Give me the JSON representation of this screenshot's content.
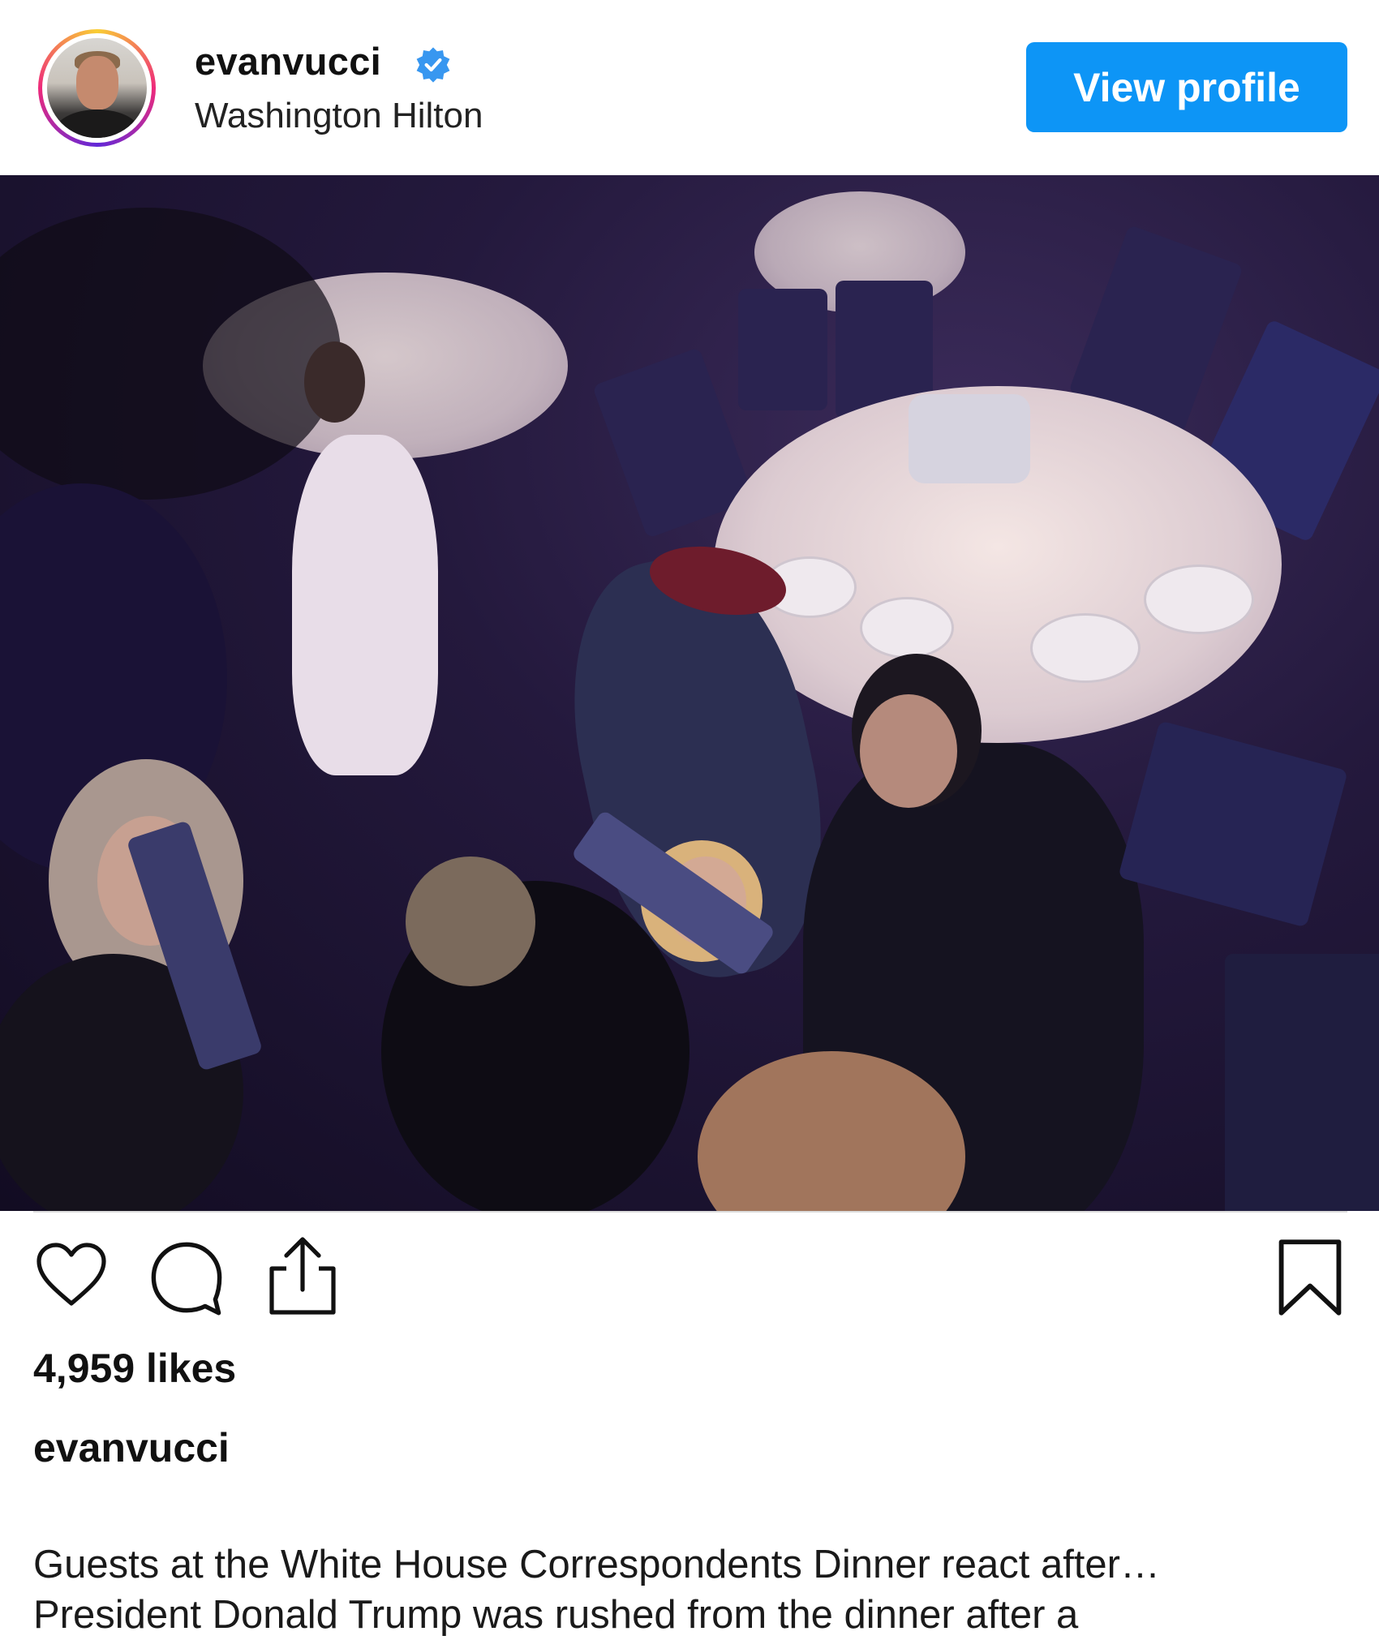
{
  "post": {
    "username": "evanvucci",
    "verified": true,
    "location": "Washington Hilton",
    "view_profile_label": "View profile",
    "photo_alt": "Guests at the White House Correspondents Dinner",
    "likes": "4,959 likes",
    "caption_username": "evanvucci",
    "caption_line1": "Guests at the White House Correspondents Dinner react after…",
    "caption_line2": "President Donald Trump was rushed from the dinner after a"
  },
  "icons": {
    "like": "heart-icon",
    "comment": "comment-icon",
    "share": "share-icon",
    "save": "bookmark-icon",
    "verified": "verified-badge-icon"
  },
  "colors": {
    "accent": "#0d95f6",
    "verified": "#3897f0"
  }
}
